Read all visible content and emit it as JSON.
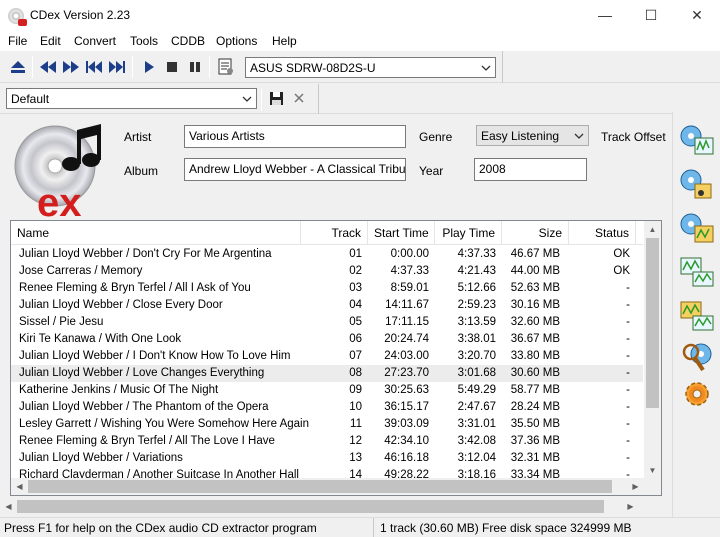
{
  "window": {
    "title": "CDex Version 2.23",
    "minimize": "—",
    "maximize": "☐",
    "close": "✕"
  },
  "menu": [
    "File",
    "Edit",
    "Convert",
    "Tools",
    "CDDB",
    "Options",
    "Help"
  ],
  "toolbar": {
    "drive": "ASUS    SDRW-08D2S-U"
  },
  "profile": {
    "value": "Default"
  },
  "info": {
    "artist_label": "Artist",
    "artist_value": "Various Artists",
    "album_label": "Album",
    "album_value": "Andrew Lloyd Webber - A Classical Tribute",
    "genre_label": "Genre",
    "genre_value": "Easy Listening",
    "year_label": "Year",
    "year_value": "2008",
    "track_offset_label": "Track Offset"
  },
  "table": {
    "columns": [
      "Name",
      "Track",
      "Start Time",
      "Play Time",
      "Size",
      "Status"
    ],
    "rows": [
      {
        "name": "Julian Lloyd Webber / Don't Cry For Me Argentina",
        "track": "01",
        "start": "0:00.00",
        "play": "4:37.33",
        "size": "46.67 MB",
        "status": "OK"
      },
      {
        "name": "Jose Carreras / Memory",
        "track": "02",
        "start": "4:37.33",
        "play": "4:21.43",
        "size": "44.00 MB",
        "status": "OK"
      },
      {
        "name": "Renee Fleming & Bryn Terfel / All I Ask of You",
        "track": "03",
        "start": "8:59.01",
        "play": "5:12.66",
        "size": "52.63 MB",
        "status": "-"
      },
      {
        "name": "Julian Lloyd Webber / Close Every Door",
        "track": "04",
        "start": "14:11.67",
        "play": "2:59.23",
        "size": "30.16 MB",
        "status": "-"
      },
      {
        "name": "Sissel / Pie Jesu",
        "track": "05",
        "start": "17:11.15",
        "play": "3:13.59",
        "size": "32.60 MB",
        "status": "-"
      },
      {
        "name": "Kiri Te Kanawa / With One Look",
        "track": "06",
        "start": "20:24.74",
        "play": "3:38.01",
        "size": "36.67 MB",
        "status": "-"
      },
      {
        "name": "Julian Lloyd Webber / I Don't Know How To Love Him",
        "track": "07",
        "start": "24:03.00",
        "play": "3:20.70",
        "size": "33.80 MB",
        "status": "-"
      },
      {
        "name": "Julian Lloyd Webber / Love Changes Everything",
        "track": "08",
        "start": "27:23.70",
        "play": "3:01.68",
        "size": "30.60 MB",
        "status": "-",
        "selected": true
      },
      {
        "name": "Katherine Jenkins / Music Of The Night",
        "track": "09",
        "start": "30:25.63",
        "play": "5:49.29",
        "size": "58.77 MB",
        "status": "-"
      },
      {
        "name": "Julian Lloyd Webber / The Phantom of the Opera",
        "track": "10",
        "start": "36:15.17",
        "play": "2:47.67",
        "size": "28.24 MB",
        "status": "-"
      },
      {
        "name": "Lesley Garrett / Wishing You Were Somehow Here Again",
        "track": "11",
        "start": "39:03.09",
        "play": "3:31.01",
        "size": "35.50 MB",
        "status": "-"
      },
      {
        "name": "Renee Fleming & Bryn Terfel / All The Love I Have",
        "track": "12",
        "start": "42:34.10",
        "play": "3:42.08",
        "size": "37.36 MB",
        "status": "-"
      },
      {
        "name": "Julian Lloyd Webber / Variations",
        "track": "13",
        "start": "46:16.18",
        "play": "3:12.04",
        "size": "32.31 MB",
        "status": "-"
      },
      {
        "name": "Richard Clayderman / Another Suitcase In Another Hall",
        "track": "14",
        "start": "49:28.22",
        "play": "3:18.16",
        "size": "33.34 MB",
        "status": "-"
      }
    ]
  },
  "statusbar": {
    "help": "Press F1 for help on the CDex audio CD extractor program",
    "info": "1 track (30.60 MB) Free disk space 324999 MB"
  },
  "icons": {
    "eject": "eject-icon",
    "prev": "previous-track-icon",
    "next": "next-track-icon",
    "skip_back": "skip-back-icon",
    "skip_forward": "skip-forward-icon",
    "play": "play-icon",
    "stop": "stop-icon",
    "pause": "pause-icon",
    "cddb": "cddb-query-icon",
    "save": "save-icon",
    "delete": "delete-icon"
  }
}
